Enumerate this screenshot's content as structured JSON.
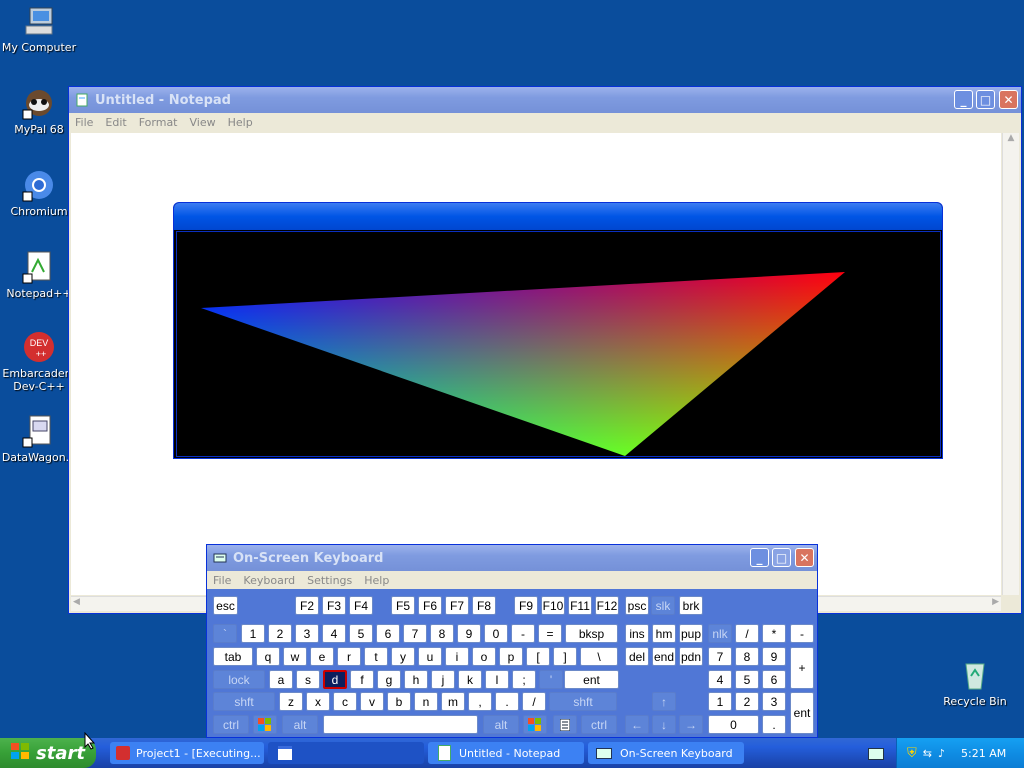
{
  "desktop": {
    "icons": [
      {
        "label": "My Computer",
        "icon": "my-computer-icon"
      },
      {
        "label": "MyPal 68",
        "icon": "mypal-icon"
      },
      {
        "label": "Chromium",
        "icon": "chromium-icon"
      },
      {
        "label": "Notepad++",
        "icon": "notepadpp-icon"
      },
      {
        "label": "Embarcadero Dev-C++",
        "icon": "devcpp-icon"
      },
      {
        "label": "DataWagon...",
        "icon": "datawagon-icon"
      },
      {
        "label": "Recycle Bin",
        "icon": "recycle-bin-icon"
      }
    ]
  },
  "notepad": {
    "title": "Untitled - Notepad",
    "menu": [
      "File",
      "Edit",
      "Format",
      "View",
      "Help"
    ]
  },
  "gl_window": {
    "colors": {
      "top_left": "#0000ff",
      "top_right": "#ff0000",
      "bottom": "#00ff00",
      "background": "#000000"
    }
  },
  "osk": {
    "title": "On-Screen Keyboard",
    "menu": [
      "File",
      "Keyboard",
      "Settings",
      "Help"
    ],
    "pressed_key": "d",
    "rows": {
      "fn": [
        "esc",
        "F2",
        "F3",
        "F4",
        "F5",
        "F6",
        "F7",
        "F8",
        "F9",
        "F10",
        "F11",
        "F12",
        "psc",
        "slk",
        "brk"
      ],
      "num": [
        "`",
        "1",
        "2",
        "3",
        "4",
        "5",
        "6",
        "7",
        "8",
        "9",
        "0",
        "-",
        "=",
        "bksp",
        "ins",
        "hm",
        "pup",
        "nlk",
        "/",
        "*",
        "-"
      ],
      "tab": [
        "tab",
        "q",
        "w",
        "e",
        "r",
        "t",
        "y",
        "u",
        "i",
        "o",
        "p",
        "[",
        "]",
        "\\",
        "del",
        "end",
        "pdn",
        "7",
        "8",
        "9",
        "+"
      ],
      "caps": [
        "lock",
        "a",
        "s",
        "d",
        "f",
        "g",
        "h",
        "j",
        "k",
        "l",
        ";",
        "'",
        "ent",
        "4",
        "5",
        "6"
      ],
      "shift": [
        "shft",
        "z",
        "x",
        "c",
        "v",
        "b",
        "n",
        "m",
        ",",
        ".",
        "/",
        "shft",
        "↑",
        "1",
        "2",
        "3",
        "ent"
      ],
      "ctrl": [
        "ctrl",
        "alt",
        "alt",
        "ctrl",
        "←",
        "↓",
        "→",
        "0",
        "."
      ]
    }
  },
  "taskbar": {
    "start_label": "start",
    "buttons": [
      "Project1 - [Executing...",
      "",
      "Untitled - Notepad",
      "On-Screen Keyboard"
    ],
    "clock": "5:21 AM"
  }
}
